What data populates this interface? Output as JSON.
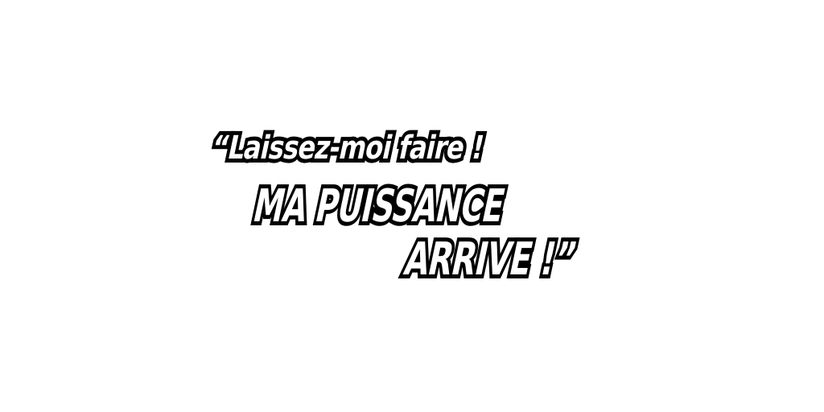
{
  "caption": {
    "line1": "“Laissez-moi faire !",
    "line2": "MA PUISSANCE",
    "line3": "ARRIVE !”"
  },
  "colors": {
    "background": "#ffffff",
    "text_fill": "#ffffff",
    "text_outline": "#000000"
  }
}
